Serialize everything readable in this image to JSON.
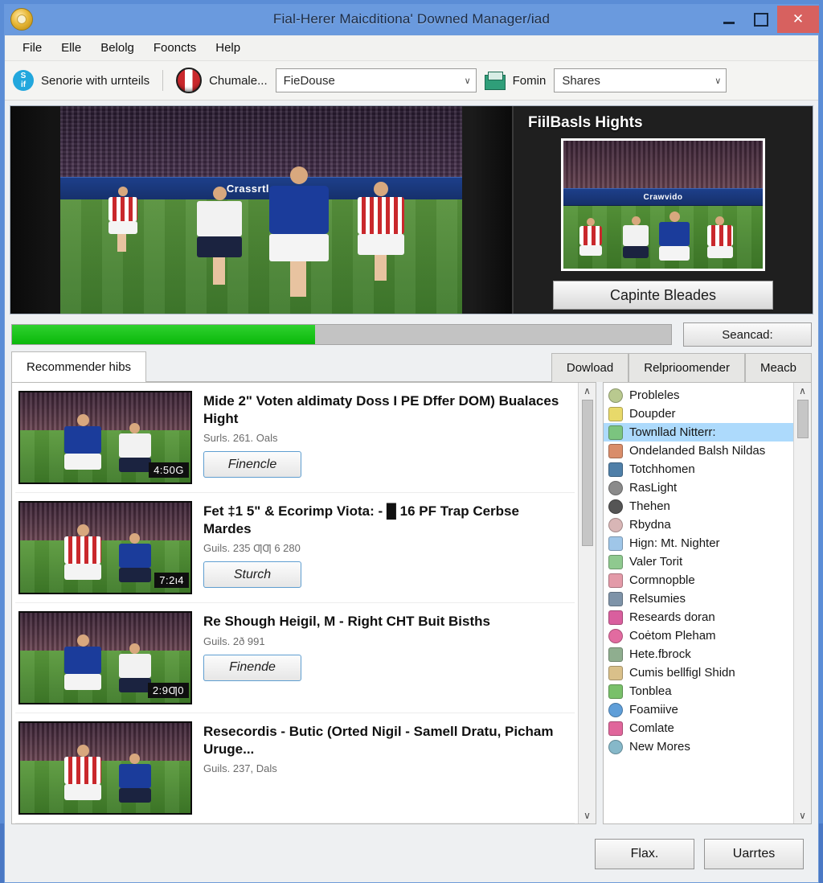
{
  "window": {
    "title": "Fial-Herer Maicditionaʹ Downed Manager/iad",
    "controls": {
      "minimize": "–",
      "maximize": "□",
      "close": "✕"
    }
  },
  "menubar": {
    "items": [
      "File",
      "Elle",
      "Belolg",
      "Fooncts",
      "Help"
    ]
  },
  "toolbar": {
    "sync_label": "Senorie with urnteils",
    "sync_icon_top": "S",
    "sync_icon_bottom": "if",
    "channel_label": "Chumale...",
    "source_select": {
      "value": "FieDouse",
      "arrow": "∨"
    },
    "folder_label": "Fomin",
    "shares_select": {
      "value": "Shares",
      "arrow": "∨"
    }
  },
  "preview": {
    "main_adboard": "Crassrtloons",
    "side_title": "FiilBasls Hights",
    "side_thumb_adboard": "Crawvido",
    "capture_button": "Capinte Bleades"
  },
  "progress": {
    "percent": 46,
    "scan_button": "Seancad:"
  },
  "tabs": {
    "left": [
      {
        "label": "Recommender hibs",
        "active": true
      }
    ],
    "right": [
      {
        "label": "Dowload",
        "active": false
      },
      {
        "label": "Relprioomender",
        "active": false
      },
      {
        "label": "Meacb",
        "active": false
      }
    ]
  },
  "video_list": {
    "items": [
      {
        "title": "Mide 2\" Voten aldimaty Doss I PE Dffer DOM) Bualaces Hight",
        "meta": "Surls. 261. Oals",
        "duration": "4:50G",
        "action": "Finencle"
      },
      {
        "title": "Fet ‡1 5\" & Ecorimp Viota: - █ 16 PF Trap Cerbse Mardes",
        "meta": "Guils. 235 ƢƢ 6 280",
        "duration": "7:2ι4",
        "action": "Sturch"
      },
      {
        "title": "Re Shough Heigil, M - Right CHT Buit Bisths",
        "meta": "Guils. 2ð 991",
        "duration": "2:9Ƣ0",
        "action": "Finende"
      },
      {
        "title": "Resecordis - Butic (Orted Nigil - Samell Dratu, Picham Uruge...",
        "meta": "Guils. 237, Dals",
        "duration": "",
        "action": ""
      }
    ],
    "scroll_up": "∧",
    "scroll_down": "∨"
  },
  "side_list": {
    "items": [
      {
        "label": "Probleles",
        "color": "#b9c98f",
        "round": true,
        "selected": false
      },
      {
        "label": "Doupder",
        "color": "#e8d96a",
        "round": false,
        "selected": false
      },
      {
        "label": "Townllad Nitterr:",
        "color": "#7bc47f",
        "round": false,
        "selected": true
      },
      {
        "label": "Ondelanded Balsh Nildas",
        "color": "#d98d6a",
        "round": false,
        "selected": false
      },
      {
        "label": "Totchhomen",
        "color": "#4f7fa8",
        "round": false,
        "selected": false
      },
      {
        "label": "RasLight",
        "color": "#8a8a8a",
        "round": true,
        "selected": false
      },
      {
        "label": "Thehen",
        "color": "#555555",
        "round": true,
        "selected": false
      },
      {
        "label": "Rbydna",
        "color": "#d8b6b6",
        "round": true,
        "selected": false
      },
      {
        "label": "Hign: Mt. Nighter",
        "color": "#9fc6e8",
        "round": false,
        "selected": false
      },
      {
        "label": "Valer Torit",
        "color": "#8fc98f",
        "round": false,
        "selected": false
      },
      {
        "label": "Cormnopble",
        "color": "#e39aa8",
        "round": false,
        "selected": false
      },
      {
        "label": "Relsumies",
        "color": "#7e93a8",
        "round": false,
        "selected": false
      },
      {
        "label": "Researds doran",
        "color": "#d95f9e",
        "round": false,
        "selected": false
      },
      {
        "label": "Coėtom Pleham",
        "color": "#e26ba0",
        "round": true,
        "selected": false
      },
      {
        "label": "Hete.fbrock",
        "color": "#8fae8f",
        "round": false,
        "selected": false
      },
      {
        "label": "Cumis bellfigl Shidn",
        "color": "#d9c08a",
        "round": false,
        "selected": false
      },
      {
        "label": "Tonblea",
        "color": "#79c06a",
        "round": false,
        "selected": false
      },
      {
        "label": "Foamiive",
        "color": "#5f9ed8",
        "round": true,
        "selected": false
      },
      {
        "label": "Comlate",
        "color": "#e0669b",
        "round": false,
        "selected": false
      },
      {
        "label": "New Mores",
        "color": "#86b8c9",
        "round": true,
        "selected": false
      }
    ],
    "scroll_up": "∧",
    "scroll_down": "∨"
  },
  "footer": {
    "buttons": [
      "Flax.",
      "Uarrtes"
    ]
  },
  "colors": {
    "titlebar": "#6a9ade",
    "close_button": "#d7615f",
    "progress_fill": "#12c312",
    "selection": "#addafc",
    "accent_border": "#5f9ed0"
  }
}
